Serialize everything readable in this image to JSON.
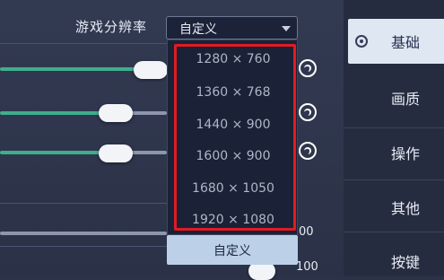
{
  "settings": {
    "resolution_label": "游戏分辨率",
    "resolution_value": "自定义"
  },
  "dropdown": {
    "options": [
      "1280 × 760",
      "1360 × 768",
      "1440 × 900",
      "1600 × 900",
      "1680 × 1050",
      "1920 × 1080"
    ],
    "custom_button": "自定义"
  },
  "sliders": {
    "values_visible": [
      "00",
      "100"
    ]
  },
  "nav": {
    "items": [
      "基础",
      "画质",
      "操作",
      "其他",
      "按键"
    ]
  },
  "colors": {
    "accent_green": "#3fae8c",
    "highlight_red": "#e11b22",
    "active_tab": "#dfe7f2"
  }
}
